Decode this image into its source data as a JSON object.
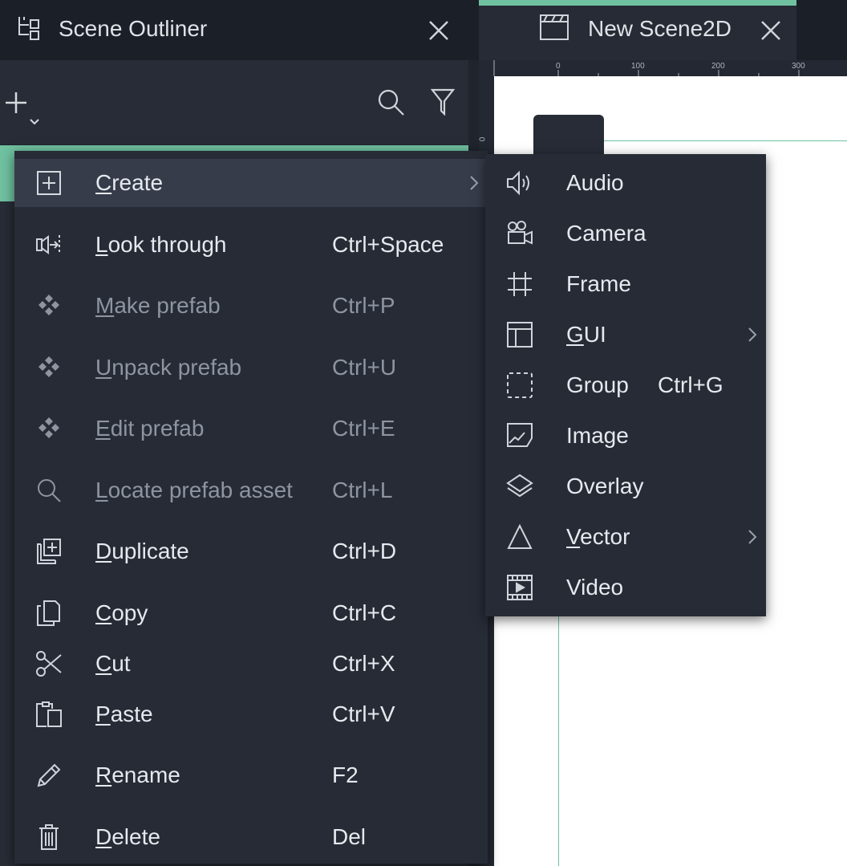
{
  "outliner": {
    "title": "Scene Outliner"
  },
  "scene_tab": {
    "label": "New Scene2D"
  },
  "ruler": {
    "top_labels": [
      "0",
      "100",
      "200",
      "300"
    ],
    "left_label": "0"
  },
  "context_menu": {
    "items": [
      {
        "label": "Create",
        "mnemonic": "C",
        "shortcut": "",
        "icon": "create-icon",
        "submenu": true,
        "disabled": false
      },
      {
        "label": "Look through",
        "mnemonic": "L",
        "shortcut": "Ctrl+Space",
        "icon": "look-through-icon",
        "submenu": false,
        "disabled": false
      },
      {
        "label": "Make prefab",
        "mnemonic": "M",
        "shortcut": "Ctrl+P",
        "icon": "prefab-icon",
        "submenu": false,
        "disabled": true
      },
      {
        "label": "Unpack prefab",
        "mnemonic": "U",
        "shortcut": "Ctrl+U",
        "icon": "prefab-icon",
        "submenu": false,
        "disabled": true
      },
      {
        "label": "Edit prefab",
        "mnemonic": "E",
        "shortcut": "Ctrl+E",
        "icon": "prefab-icon",
        "submenu": false,
        "disabled": true
      },
      {
        "label": "Locate prefab asset",
        "mnemonic": "L",
        "shortcut": "Ctrl+L",
        "icon": "search-icon",
        "submenu": false,
        "disabled": true
      },
      {
        "label": "Duplicate",
        "mnemonic": "D",
        "shortcut": "Ctrl+D",
        "icon": "duplicate-icon",
        "submenu": false,
        "disabled": false
      },
      {
        "label": "Copy",
        "mnemonic": "C",
        "shortcut": "Ctrl+C",
        "icon": "copy-icon",
        "submenu": false,
        "disabled": false
      },
      {
        "label": "Cut",
        "mnemonic": "C",
        "shortcut": "Ctrl+X",
        "icon": "scissors-icon",
        "submenu": false,
        "disabled": false
      },
      {
        "label": "Paste",
        "mnemonic": "P",
        "shortcut": "Ctrl+V",
        "icon": "paste-icon",
        "submenu": false,
        "disabled": false
      },
      {
        "label": "Rename",
        "mnemonic": "R",
        "shortcut": "F2",
        "icon": "pencil-icon",
        "submenu": false,
        "disabled": false
      },
      {
        "label": "Delete",
        "mnemonic": "D",
        "shortcut": "Del",
        "icon": "trash-icon",
        "submenu": false,
        "disabled": false
      }
    ]
  },
  "create_submenu": {
    "items": [
      {
        "label": "Audio",
        "mnemonic": "",
        "shortcut": "",
        "icon": "speaker-icon",
        "submenu": false
      },
      {
        "label": "Camera",
        "mnemonic": "",
        "shortcut": "",
        "icon": "camera-icon",
        "submenu": false
      },
      {
        "label": "Frame",
        "mnemonic": "",
        "shortcut": "",
        "icon": "frame-icon",
        "submenu": false
      },
      {
        "label": "GUI",
        "mnemonic": "G",
        "shortcut": "",
        "icon": "gui-layout-icon",
        "submenu": true
      },
      {
        "label": "Group",
        "mnemonic": "",
        "shortcut": "Ctrl+G",
        "icon": "group-icon",
        "submenu": false
      },
      {
        "label": "Image",
        "mnemonic": "",
        "shortcut": "",
        "icon": "image-icon",
        "submenu": false
      },
      {
        "label": "Overlay",
        "mnemonic": "",
        "shortcut": "",
        "icon": "layers-icon",
        "submenu": false
      },
      {
        "label": "Vector",
        "mnemonic": "V",
        "shortcut": "",
        "icon": "triangle-icon",
        "submenu": true
      },
      {
        "label": "Video",
        "mnemonic": "",
        "shortcut": "",
        "icon": "film-icon",
        "submenu": false
      }
    ]
  },
  "colors": {
    "accent": "#6fc1a0",
    "menu_bg": "#262b36",
    "highlight": "#363c4a",
    "disabled_text": "#8e95a1"
  }
}
